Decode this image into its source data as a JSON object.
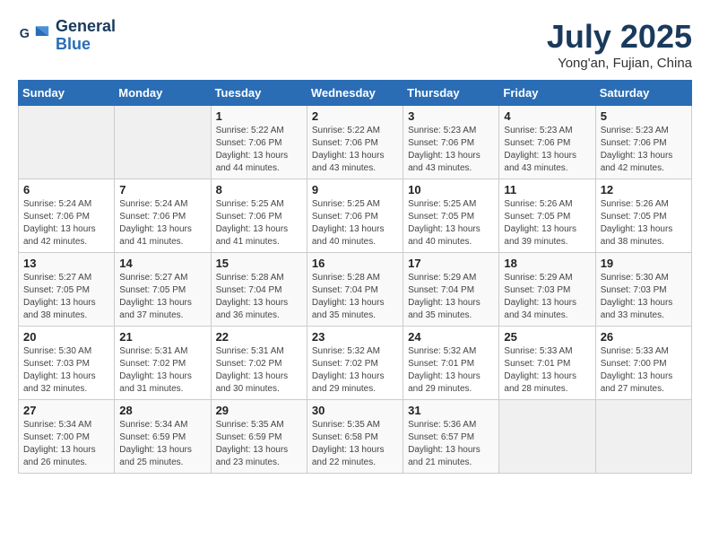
{
  "header": {
    "logo_line1": "General",
    "logo_line2": "Blue",
    "month": "July 2025",
    "location": "Yong'an, Fujian, China"
  },
  "weekdays": [
    "Sunday",
    "Monday",
    "Tuesday",
    "Wednesday",
    "Thursday",
    "Friday",
    "Saturday"
  ],
  "weeks": [
    [
      {
        "day": "",
        "info": ""
      },
      {
        "day": "",
        "info": ""
      },
      {
        "day": "1",
        "info": "Sunrise: 5:22 AM\nSunset: 7:06 PM\nDaylight: 13 hours and 44 minutes."
      },
      {
        "day": "2",
        "info": "Sunrise: 5:22 AM\nSunset: 7:06 PM\nDaylight: 13 hours and 43 minutes."
      },
      {
        "day": "3",
        "info": "Sunrise: 5:23 AM\nSunset: 7:06 PM\nDaylight: 13 hours and 43 minutes."
      },
      {
        "day": "4",
        "info": "Sunrise: 5:23 AM\nSunset: 7:06 PM\nDaylight: 13 hours and 43 minutes."
      },
      {
        "day": "5",
        "info": "Sunrise: 5:23 AM\nSunset: 7:06 PM\nDaylight: 13 hours and 42 minutes."
      }
    ],
    [
      {
        "day": "6",
        "info": "Sunrise: 5:24 AM\nSunset: 7:06 PM\nDaylight: 13 hours and 42 minutes."
      },
      {
        "day": "7",
        "info": "Sunrise: 5:24 AM\nSunset: 7:06 PM\nDaylight: 13 hours and 41 minutes."
      },
      {
        "day": "8",
        "info": "Sunrise: 5:25 AM\nSunset: 7:06 PM\nDaylight: 13 hours and 41 minutes."
      },
      {
        "day": "9",
        "info": "Sunrise: 5:25 AM\nSunset: 7:06 PM\nDaylight: 13 hours and 40 minutes."
      },
      {
        "day": "10",
        "info": "Sunrise: 5:25 AM\nSunset: 7:05 PM\nDaylight: 13 hours and 40 minutes."
      },
      {
        "day": "11",
        "info": "Sunrise: 5:26 AM\nSunset: 7:05 PM\nDaylight: 13 hours and 39 minutes."
      },
      {
        "day": "12",
        "info": "Sunrise: 5:26 AM\nSunset: 7:05 PM\nDaylight: 13 hours and 38 minutes."
      }
    ],
    [
      {
        "day": "13",
        "info": "Sunrise: 5:27 AM\nSunset: 7:05 PM\nDaylight: 13 hours and 38 minutes."
      },
      {
        "day": "14",
        "info": "Sunrise: 5:27 AM\nSunset: 7:05 PM\nDaylight: 13 hours and 37 minutes."
      },
      {
        "day": "15",
        "info": "Sunrise: 5:28 AM\nSunset: 7:04 PM\nDaylight: 13 hours and 36 minutes."
      },
      {
        "day": "16",
        "info": "Sunrise: 5:28 AM\nSunset: 7:04 PM\nDaylight: 13 hours and 35 minutes."
      },
      {
        "day": "17",
        "info": "Sunrise: 5:29 AM\nSunset: 7:04 PM\nDaylight: 13 hours and 35 minutes."
      },
      {
        "day": "18",
        "info": "Sunrise: 5:29 AM\nSunset: 7:03 PM\nDaylight: 13 hours and 34 minutes."
      },
      {
        "day": "19",
        "info": "Sunrise: 5:30 AM\nSunset: 7:03 PM\nDaylight: 13 hours and 33 minutes."
      }
    ],
    [
      {
        "day": "20",
        "info": "Sunrise: 5:30 AM\nSunset: 7:03 PM\nDaylight: 13 hours and 32 minutes."
      },
      {
        "day": "21",
        "info": "Sunrise: 5:31 AM\nSunset: 7:02 PM\nDaylight: 13 hours and 31 minutes."
      },
      {
        "day": "22",
        "info": "Sunrise: 5:31 AM\nSunset: 7:02 PM\nDaylight: 13 hours and 30 minutes."
      },
      {
        "day": "23",
        "info": "Sunrise: 5:32 AM\nSunset: 7:02 PM\nDaylight: 13 hours and 29 minutes."
      },
      {
        "day": "24",
        "info": "Sunrise: 5:32 AM\nSunset: 7:01 PM\nDaylight: 13 hours and 29 minutes."
      },
      {
        "day": "25",
        "info": "Sunrise: 5:33 AM\nSunset: 7:01 PM\nDaylight: 13 hours and 28 minutes."
      },
      {
        "day": "26",
        "info": "Sunrise: 5:33 AM\nSunset: 7:00 PM\nDaylight: 13 hours and 27 minutes."
      }
    ],
    [
      {
        "day": "27",
        "info": "Sunrise: 5:34 AM\nSunset: 7:00 PM\nDaylight: 13 hours and 26 minutes."
      },
      {
        "day": "28",
        "info": "Sunrise: 5:34 AM\nSunset: 6:59 PM\nDaylight: 13 hours and 25 minutes."
      },
      {
        "day": "29",
        "info": "Sunrise: 5:35 AM\nSunset: 6:59 PM\nDaylight: 13 hours and 23 minutes."
      },
      {
        "day": "30",
        "info": "Sunrise: 5:35 AM\nSunset: 6:58 PM\nDaylight: 13 hours and 22 minutes."
      },
      {
        "day": "31",
        "info": "Sunrise: 5:36 AM\nSunset: 6:57 PM\nDaylight: 13 hours and 21 minutes."
      },
      {
        "day": "",
        "info": ""
      },
      {
        "day": "",
        "info": ""
      }
    ]
  ]
}
